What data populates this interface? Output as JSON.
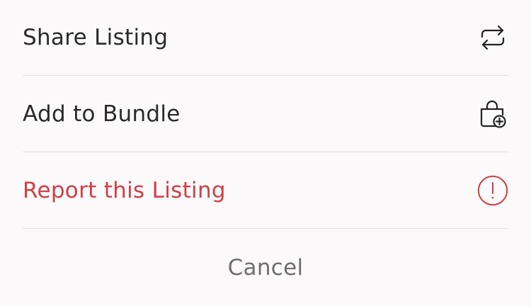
{
  "actions": [
    {
      "label": "Share Listing",
      "icon": "share-icon"
    },
    {
      "label": "Add to Bundle",
      "icon": "bundle-bag-icon"
    },
    {
      "label": "Report this Listing",
      "icon": "alert-circle-icon",
      "color": "#cf3f46"
    }
  ],
  "cancel_label": "Cancel",
  "colors": {
    "background": "#fbf9fa",
    "text": "#2a2a2a",
    "danger": "#cf3f46",
    "cancel": "#6e6e6e",
    "divider": "#e3e1e2"
  }
}
